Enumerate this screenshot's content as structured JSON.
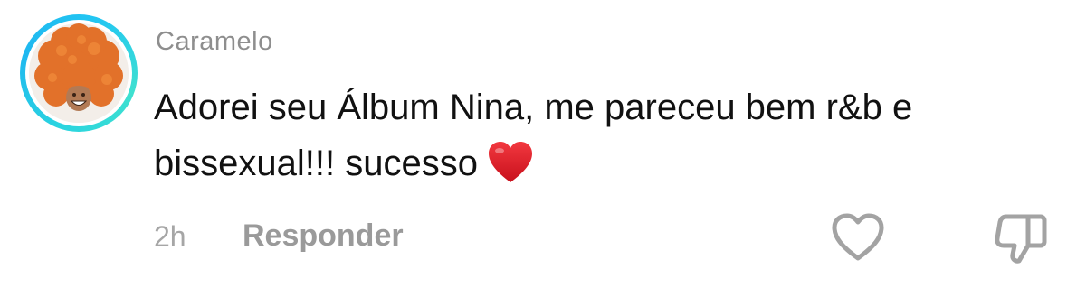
{
  "comment": {
    "username": "Caramelo",
    "text_lines": [
      "Adorei seu Álbum Nina, me pareceu bem r&b e",
      "bissexual!!! sucesso"
    ],
    "emoji": "red-heart",
    "timestamp": "2h",
    "reply_label": "Responder",
    "icons": {
      "like": "heart-outline-icon",
      "dislike": "thumbs-down-icon"
    },
    "colors": {
      "avatar_ring": "#2ad4e0",
      "username": "#8e8e8e",
      "text": "#111111",
      "meta": "#a6a6a6",
      "emoji_heart": "#e0202a"
    }
  }
}
